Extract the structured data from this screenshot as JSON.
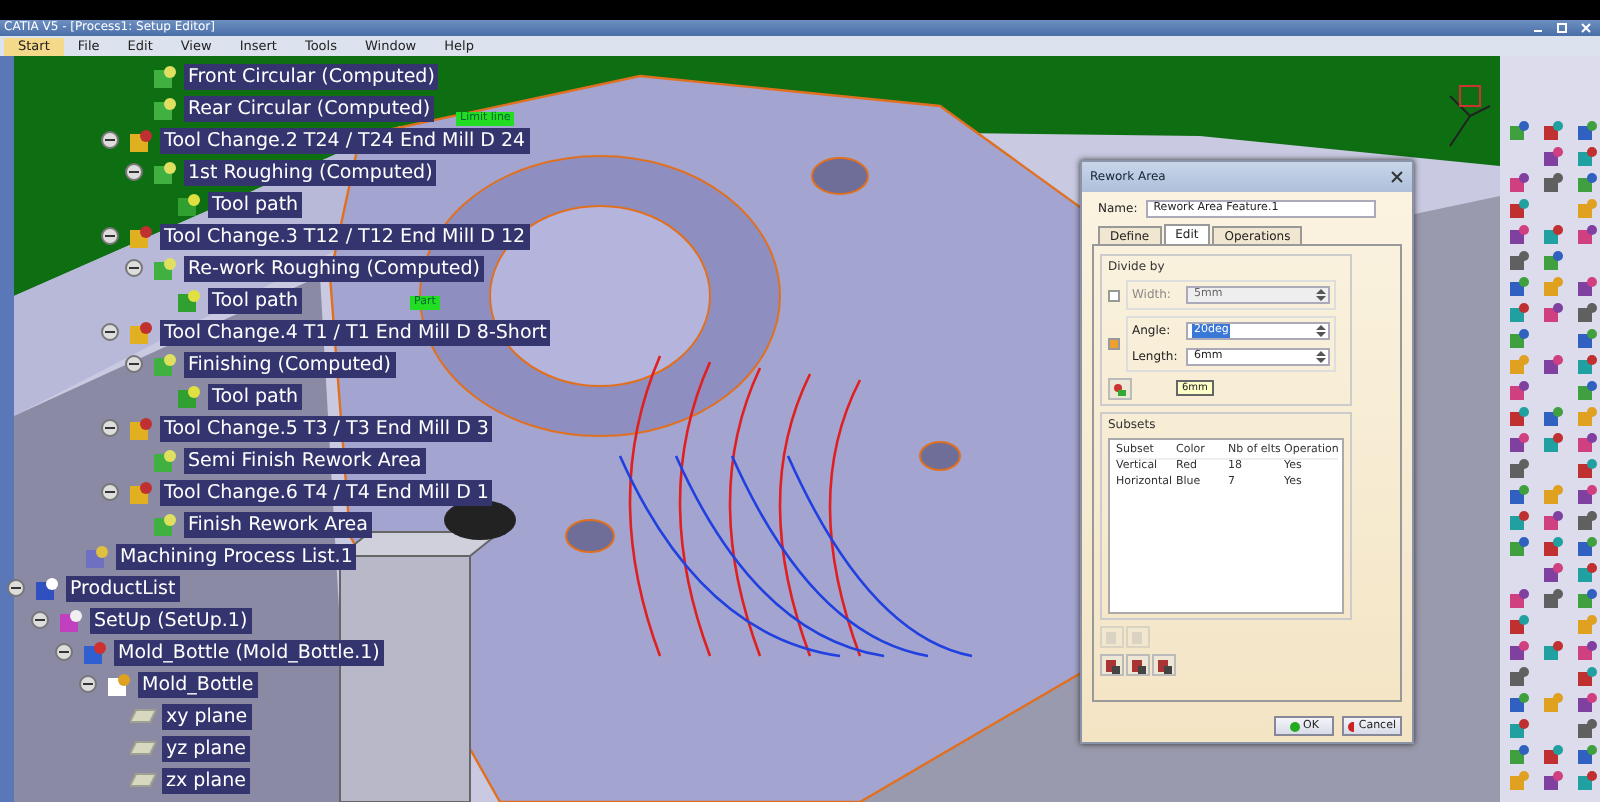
{
  "window": {
    "title": "CATIA V5 - [Process1: Setup Editor]"
  },
  "menu": [
    {
      "label": "Start",
      "selected": true
    },
    {
      "label": "File",
      "selected": false
    },
    {
      "label": "Edit",
      "selected": false
    },
    {
      "label": "View",
      "selected": false
    },
    {
      "label": "Insert",
      "selected": false
    },
    {
      "label": "Tools",
      "selected": false
    },
    {
      "label": "Window",
      "selected": false
    },
    {
      "label": "Help",
      "selected": false
    }
  ],
  "tree": {
    "program_items": [
      {
        "label": "Front Circular (Computed)",
        "kind": "operation"
      },
      {
        "label": "Rear Circular (Computed)",
        "kind": "operation"
      }
    ],
    "tool_changes": [
      {
        "label": "Tool Change.2  T24 / T24 End Mill D 24",
        "kind": "tool_change",
        "children": [
          {
            "label": "1st Roughing (Computed)",
            "kind": "operation",
            "children": [
              {
                "label": "Tool path",
                "kind": "tool_path"
              }
            ]
          }
        ]
      },
      {
        "label": "Tool Change.3  T12 / T12 End Mill D 12",
        "kind": "tool_change",
        "children": [
          {
            "label": "Re-work Roughing (Computed)",
            "kind": "operation",
            "children": [
              {
                "label": "Tool path",
                "kind": "tool_path"
              }
            ]
          }
        ]
      },
      {
        "label": "Tool Change.4  T1 / T1 End Mill D 8-Short",
        "kind": "tool_change",
        "children": [
          {
            "label": "Finishing (Computed)",
            "kind": "operation",
            "children": [
              {
                "label": "Tool path",
                "kind": "tool_path"
              }
            ]
          }
        ]
      },
      {
        "label": "Tool Change.5  T3 / T3 End Mill D 3",
        "kind": "tool_change",
        "children": [
          {
            "label": "Semi Finish Rework Area",
            "kind": "operation"
          }
        ]
      },
      {
        "label": "Tool Change.6  T4 / T4 End Mill D 1",
        "kind": "tool_change",
        "children": [
          {
            "label": "Finish Rework Area",
            "kind": "operation"
          }
        ]
      }
    ],
    "process_list": {
      "label": "Machining Process List.1",
      "kind": "process_list"
    },
    "products": [
      {
        "label": "ProductList",
        "kind": "product",
        "children": [
          {
            "label": "SetUp (SetUp.1)",
            "kind": "setup",
            "children": [
              {
                "label": "Mold_Bottle (Mold_Bottle.1)",
                "kind": "part",
                "children": [
                  {
                    "label": "Mold_Bottle",
                    "kind": "part_body",
                    "children": [
                      {
                        "label": "xy plane",
                        "kind": "plane"
                      },
                      {
                        "label": "yz plane",
                        "kind": "plane"
                      },
                      {
                        "label": "zx plane",
                        "kind": "plane"
                      }
                    ]
                  }
                ]
              }
            ]
          }
        ]
      }
    ]
  },
  "viewport": {
    "tags": [
      {
        "label": "Limit line",
        "kind": "limit"
      },
      {
        "label": "Part",
        "kind": "part"
      }
    ]
  },
  "dialog": {
    "title": "Rework Area",
    "name_label": "Name:",
    "name_value": "Rework Area Feature.1",
    "tabs": [
      {
        "label": "Define",
        "selected": false
      },
      {
        "label": "Edit",
        "selected": true
      },
      {
        "label": "Operations",
        "selected": false
      }
    ],
    "divide_by": {
      "title": "Divide by",
      "options": [
        {
          "checked": false,
          "fields": [
            {
              "label": "Width:",
              "value": "5mm",
              "disabled": true,
              "highlighted": false
            }
          ]
        },
        {
          "checked": true,
          "fields": [
            {
              "label": "Angle:",
              "value": "20deg",
              "disabled": false,
              "highlighted": true
            },
            {
              "label": "Length:",
              "value": "6mm",
              "disabled": false,
              "highlighted": false
            }
          ]
        }
      ]
    },
    "tooltip": "6mm",
    "subsets": {
      "title": "Subsets",
      "columns": [
        "Subset",
        "Color",
        "Nb of elts",
        "Operation"
      ],
      "rows": [
        [
          "Vertical",
          "Red",
          "18",
          "Yes"
        ],
        [
          "Horizontal",
          "Blue",
          "7",
          "Yes"
        ]
      ]
    },
    "tool_buttons": [
      {
        "disabled": true
      },
      {
        "disabled": true
      },
      {
        "disabled": false
      },
      {
        "disabled": false
      },
      {
        "disabled": false
      }
    ],
    "buttons": [
      {
        "label": "OK",
        "kind": "ok"
      },
      {
        "label": "Cancel",
        "kind": "cancel"
      }
    ]
  }
}
